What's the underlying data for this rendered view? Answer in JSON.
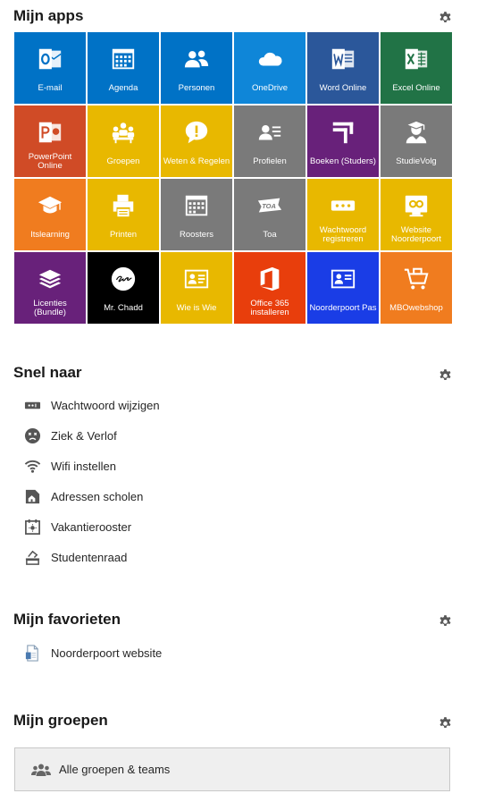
{
  "apps": {
    "title": "Mijn apps",
    "tiles": [
      {
        "label": "E-mail",
        "icon": "outlook-icon",
        "color": "#0072c6"
      },
      {
        "label": "Agenda",
        "icon": "calendar-icon",
        "color": "#0072c6"
      },
      {
        "label": "Personen",
        "icon": "people-icon",
        "color": "#0072c6"
      },
      {
        "label": "OneDrive",
        "icon": "onedrive-icon",
        "color": "#0f86d8"
      },
      {
        "label": "Word Online",
        "icon": "word-icon",
        "color": "#2b579a"
      },
      {
        "label": "Excel Online",
        "icon": "excel-icon",
        "color": "#217346"
      },
      {
        "label": "PowerPoint Online",
        "icon": "powerpoint-icon",
        "color": "#d04b26"
      },
      {
        "label": "Groepen",
        "icon": "groups-icon",
        "color": "#e8b800"
      },
      {
        "label": "Weten & Regelen",
        "icon": "speech-bubble-icon",
        "color": "#e8b800"
      },
      {
        "label": "Profielen",
        "icon": "profile-card-icon",
        "color": "#7a7a7a"
      },
      {
        "label": "Boeken (Studers)",
        "icon": "books-icon",
        "color": "#68217a"
      },
      {
        "label": "StudieVolg",
        "icon": "student-icon",
        "color": "#7a7a7a"
      },
      {
        "label": "Itslearning",
        "icon": "graduation-cap-icon",
        "color": "#f07c1f"
      },
      {
        "label": "Printen",
        "icon": "printer-icon",
        "color": "#e8b800"
      },
      {
        "label": "Roosters",
        "icon": "schedule-icon",
        "color": "#7a7a7a"
      },
      {
        "label": "Toa",
        "icon": "toa-icon",
        "color": "#7a7a7a"
      },
      {
        "label": "Wachtwoord registreren",
        "icon": "password-icon",
        "color": "#e8b800"
      },
      {
        "label": "Website Noorderpoort",
        "icon": "website-icon",
        "color": "#e8b800"
      },
      {
        "label": "Licenties (Bundle)",
        "icon": "stack-icon",
        "color": "#68217a"
      },
      {
        "label": "Mr. Chadd",
        "icon": "chadd-logo-icon",
        "color": "#000000"
      },
      {
        "label": "Wie is Wie",
        "icon": "id-card-icon",
        "color": "#e8b800"
      },
      {
        "label": "Office 365 installeren",
        "icon": "office-icon",
        "color": "#e83e0c"
      },
      {
        "label": "Noorderpoort Pas",
        "icon": "badge-icon",
        "color": "#1a3de6"
      },
      {
        "label": "MBOwebshop",
        "icon": "shopping-cart-icon",
        "color": "#f07c1f"
      }
    ]
  },
  "quick": {
    "title": "Snel naar",
    "items": [
      {
        "label": "Wachtwoord wijzigen",
        "icon": "password-icon"
      },
      {
        "label": "Ziek & Verlof",
        "icon": "sick-face-icon"
      },
      {
        "label": "Wifi instellen",
        "icon": "wifi-icon"
      },
      {
        "label": "Adressen scholen",
        "icon": "address-icon"
      },
      {
        "label": "Vakantierooster",
        "icon": "vacation-icon"
      },
      {
        "label": "Studentenraad",
        "icon": "ballot-icon"
      }
    ]
  },
  "favorites": {
    "title": "Mijn favorieten",
    "items": [
      {
        "label": "Noorderpoort website",
        "icon": "document-icon"
      }
    ]
  },
  "groups": {
    "title": "Mijn groepen",
    "all_label": "Alle groepen & teams"
  },
  "colors": {
    "accent": "#0072c6",
    "icon_gray": "#555555"
  }
}
